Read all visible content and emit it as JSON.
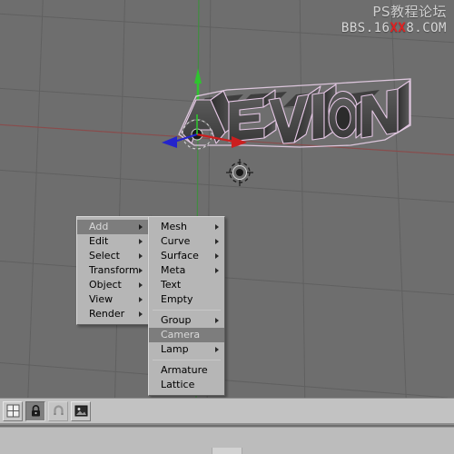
{
  "app": {
    "name": "Blender 3D Viewport"
  },
  "watermark": {
    "line_cn": "PS教程论坛",
    "line_en_pre": "BBS.16",
    "line_en_hot": "XX",
    "line_en_post": "8.COM",
    "hot_color": "#e02020"
  },
  "viewport": {
    "background_color": "#6e6e6e",
    "grid_color": "#5e5e5e",
    "x_axis_color": "#8a4a4a",
    "z_axis_color": "#3fa83f",
    "object_text": "AEVION",
    "object_face_color": "#4a4a4a",
    "object_outline_color": "#e6c8e6",
    "manipulator": {
      "x_arrow_color": "#d02020",
      "y_arrow_color": "#2020d0",
      "z_arrow_color": "#20c020",
      "widget_name": "rotate-manipulator"
    },
    "cursor_3d_name": "3d-cursor"
  },
  "menu_main": {
    "items": [
      {
        "label": "Add",
        "submenu": true,
        "highlighted": true
      },
      {
        "label": "Edit",
        "submenu": true,
        "highlighted": false
      },
      {
        "label": "Select",
        "submenu": true,
        "highlighted": false
      },
      {
        "label": "Transform",
        "submenu": true,
        "highlighted": false
      },
      {
        "label": "Object",
        "submenu": true,
        "highlighted": false
      },
      {
        "label": "View",
        "submenu": true,
        "highlighted": false
      },
      {
        "label": "Render",
        "submenu": true,
        "highlighted": false
      }
    ]
  },
  "menu_add": {
    "items": [
      {
        "label": "Mesh",
        "submenu": true,
        "highlighted": false,
        "separator_before": false
      },
      {
        "label": "Curve",
        "submenu": true,
        "highlighted": false,
        "separator_before": false
      },
      {
        "label": "Surface",
        "submenu": true,
        "highlighted": false,
        "separator_before": false
      },
      {
        "label": "Meta",
        "submenu": true,
        "highlighted": false,
        "separator_before": false
      },
      {
        "label": "Text",
        "submenu": false,
        "highlighted": false,
        "separator_before": false
      },
      {
        "label": "Empty",
        "submenu": false,
        "highlighted": false,
        "separator_before": false
      },
      {
        "label": "Group",
        "submenu": true,
        "highlighted": false,
        "separator_before": true
      },
      {
        "label": "Camera",
        "submenu": false,
        "highlighted": true,
        "separator_before": false
      },
      {
        "label": "Lamp",
        "submenu": true,
        "highlighted": false,
        "separator_before": false
      },
      {
        "label": "Armature",
        "submenu": false,
        "highlighted": false,
        "separator_before": true
      },
      {
        "label": "Lattice",
        "submenu": false,
        "highlighted": false,
        "separator_before": false
      }
    ]
  },
  "toolbar": {
    "buttons": [
      {
        "icon": "grid-view-icon",
        "active": false,
        "dim": false
      },
      {
        "icon": "lock-icon",
        "active": true,
        "dim": false
      },
      {
        "icon": "magnet-snap-icon",
        "active": false,
        "dim": true
      },
      {
        "icon": "image-render-icon",
        "active": false,
        "dim": false
      }
    ]
  }
}
